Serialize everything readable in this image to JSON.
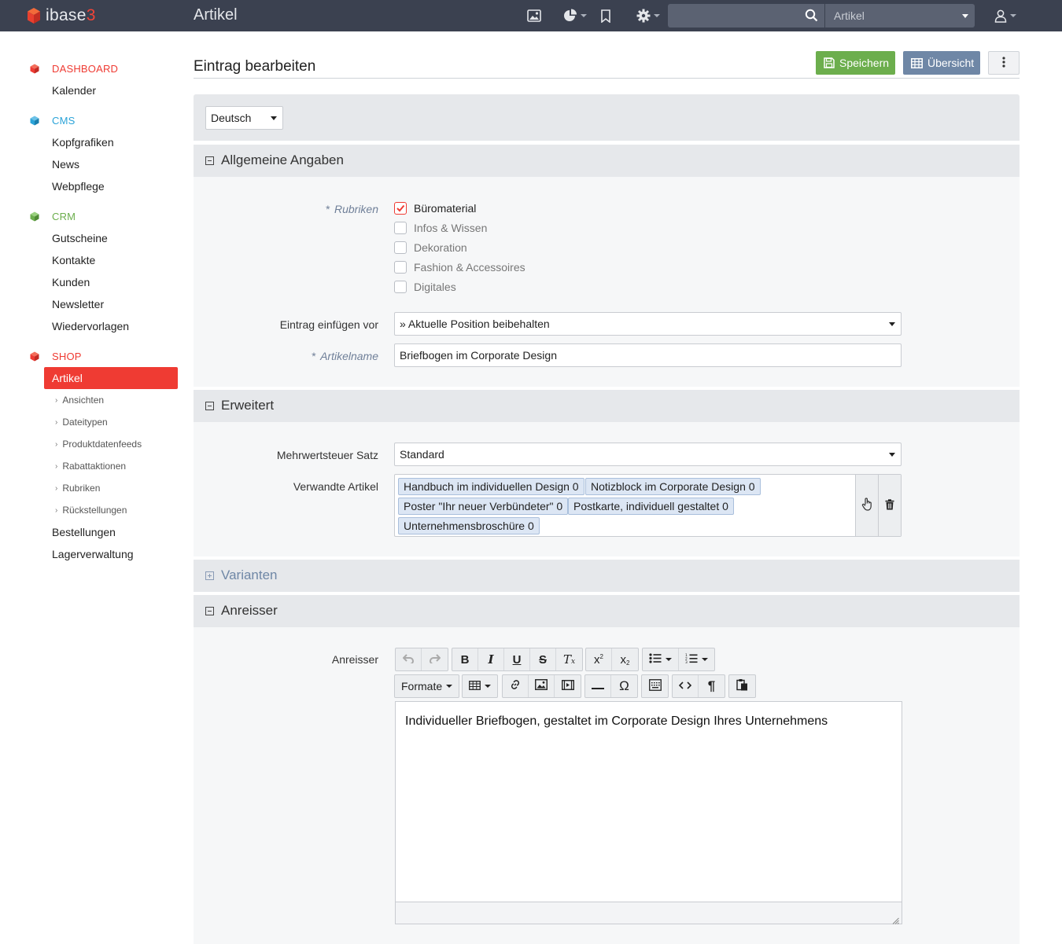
{
  "app": {
    "logo_text": "ibase",
    "logo_num": "3",
    "page_heading": "Artikel",
    "search_placeholder": "",
    "search_scope": "Artikel",
    "icons": [
      "image-icon",
      "pie-chart-icon",
      "bookmark-icon",
      "gear-icon",
      "search-icon",
      "user-icon"
    ]
  },
  "sidebar": {
    "sections": [
      {
        "label": "DASHBOARD",
        "color": "#ef3b33",
        "items": [
          "Kalender"
        ]
      },
      {
        "label": "CMS",
        "color": "#2aa3d8",
        "items": [
          "Kopfgrafiken",
          "News",
          "Webpflege"
        ]
      },
      {
        "label": "CRM",
        "color": "#6cae4d",
        "items": [
          "Gutscheine",
          "Kontakte",
          "Kunden",
          "Newsletter",
          "Wiedervorlagen"
        ]
      },
      {
        "label": "SHOP",
        "color": "#ef3b33",
        "items": [
          "Artikel",
          "Bestellungen",
          "Lagerverwaltung"
        ]
      }
    ],
    "active_item": "Artikel",
    "subitems": [
      "Ansichten",
      "Dateitypen",
      "Produktdatenfeeds",
      "Rabattaktionen",
      "Rubriken",
      "Rückstellungen"
    ]
  },
  "main": {
    "title": "Eintrag bearbeiten",
    "save_label": "Speichern",
    "overview_label": "Übersicht",
    "language": "Deutsch"
  },
  "sections": {
    "allgemein": "Allgemeine Angaben",
    "erweitert": "Erweitert",
    "varianten": "Varianten",
    "anreisser": "Anreisser"
  },
  "form": {
    "rubriken_label": "Rubriken",
    "rubriken": [
      {
        "label": "Büromaterial",
        "checked": true
      },
      {
        "label": "Infos & Wissen",
        "checked": false
      },
      {
        "label": "Dekoration",
        "checked": false
      },
      {
        "label": "Fashion & Accessoires",
        "checked": false
      },
      {
        "label": "Digitales",
        "checked": false
      }
    ],
    "position_label": "Eintrag einfügen vor",
    "position_value": "» Aktuelle Position beibehalten",
    "name_label": "Artikelname",
    "name_value": "Briefbogen im Corporate Design",
    "vat_label": "Mehrwertsteuer Satz",
    "vat_value": "Standard",
    "related_label": "Verwandte Artikel",
    "related": [
      "Handbuch im individuellen Design 0",
      "Notizblock im Corporate Design 0",
      "Poster \"Ihr neuer Verbündeter\" 0",
      "Postkarte, individuell gestaltet 0",
      "Unternehmensbroschüre 0"
    ],
    "teaser_label": "Anreisser",
    "teaser_text": "Individueller Briefbogen, gestaltet im Corporate Design Ihres Unternehmens",
    "formats_label": "Formate",
    "required_mark": "*"
  }
}
